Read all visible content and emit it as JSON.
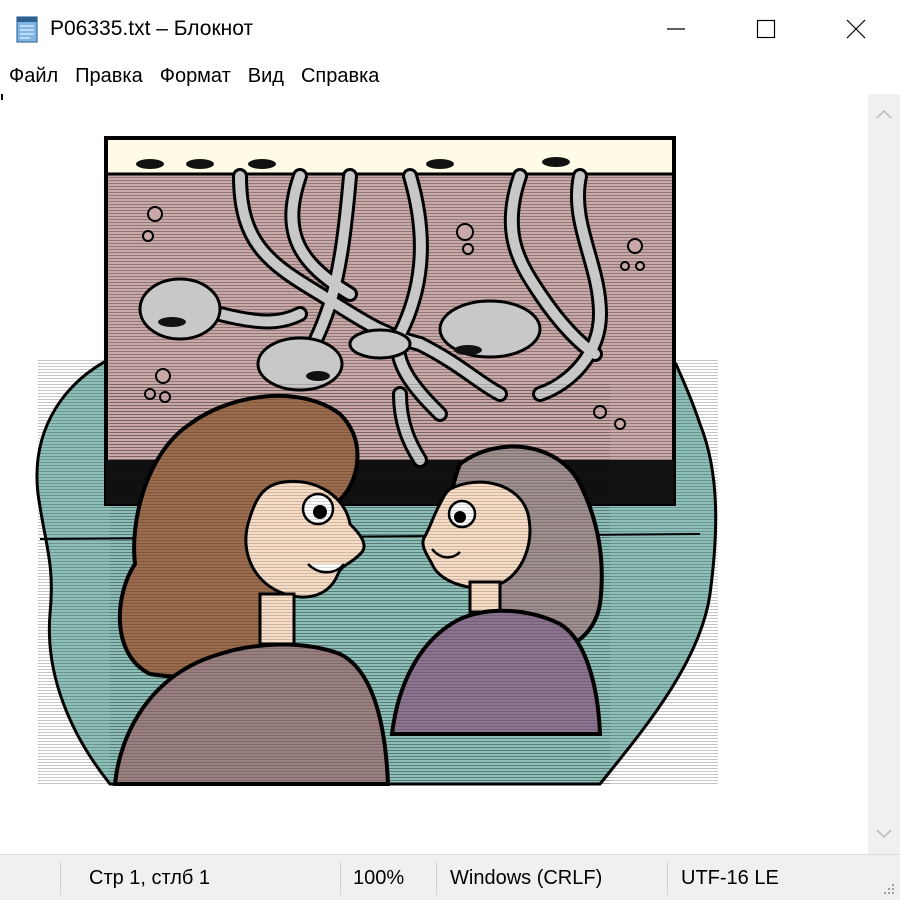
{
  "window": {
    "title": "P06335.txt – Блокнот",
    "icon": "notepad-icon",
    "buttons": {
      "minimize": "minimize-icon",
      "maximize": "maximize-icon",
      "close": "close-icon"
    }
  },
  "menu": {
    "items": [
      {
        "label": "Файл"
      },
      {
        "label": "Правка"
      },
      {
        "label": "Формат"
      },
      {
        "label": "Вид"
      },
      {
        "label": "Справка"
      }
    ]
  },
  "document": {
    "content_kind": "image-rendered-in-text-area",
    "picture_subject": "two women looking at an ant farm",
    "colors": {
      "backdrop": "#8cbfb7",
      "soil": "#c9a8a8",
      "sky_strip": "#fffbe6",
      "tunnel": "#c8c8c8",
      "hair_left": "#9a6b4c",
      "hair_right": "#9e8e8e",
      "skin": "#f7dcc6",
      "sweater_left": "#9a7f80",
      "sweater_right": "#8c7490"
    }
  },
  "scrollbar": {
    "up": "chevron-up-icon",
    "down": "chevron-down-icon"
  },
  "status": {
    "position": "Стр 1, стлб 1",
    "zoom": "100%",
    "line_endings": "Windows (CRLF)",
    "encoding": "UTF-16 LE"
  }
}
